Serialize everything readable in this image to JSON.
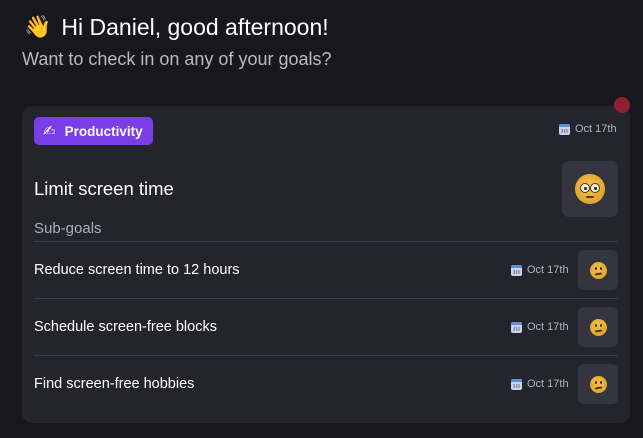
{
  "header": {
    "greeting_emoji": "👋",
    "greeting": "Hi Daniel, good afternoon!",
    "subtitle": "Want to check in on any of your goals?"
  },
  "goal": {
    "category": {
      "icon": "writing-hand-icon",
      "emoji": "✍",
      "label": "Productivity",
      "color": "#7a3ee6"
    },
    "date": "Oct 17th",
    "title": "Limit screen time",
    "mood_icon": "neutral-face-icon",
    "subgoals_label": "Sub-goals",
    "subgoals": [
      {
        "label": "Reduce screen time to 12 hours",
        "date": "Oct 17th",
        "mood_icon": "confused-face-icon"
      },
      {
        "label": "Schedule screen-free blocks",
        "date": "Oct 17th",
        "mood_icon": "confused-face-icon"
      },
      {
        "label": "Find screen-free hobbies",
        "date": "Oct 17th",
        "mood_icon": "confused-face-icon"
      }
    ]
  },
  "colors": {
    "background": "#17171d",
    "card": "#24242c",
    "button": "#35353f",
    "notification": "#8c2131"
  }
}
